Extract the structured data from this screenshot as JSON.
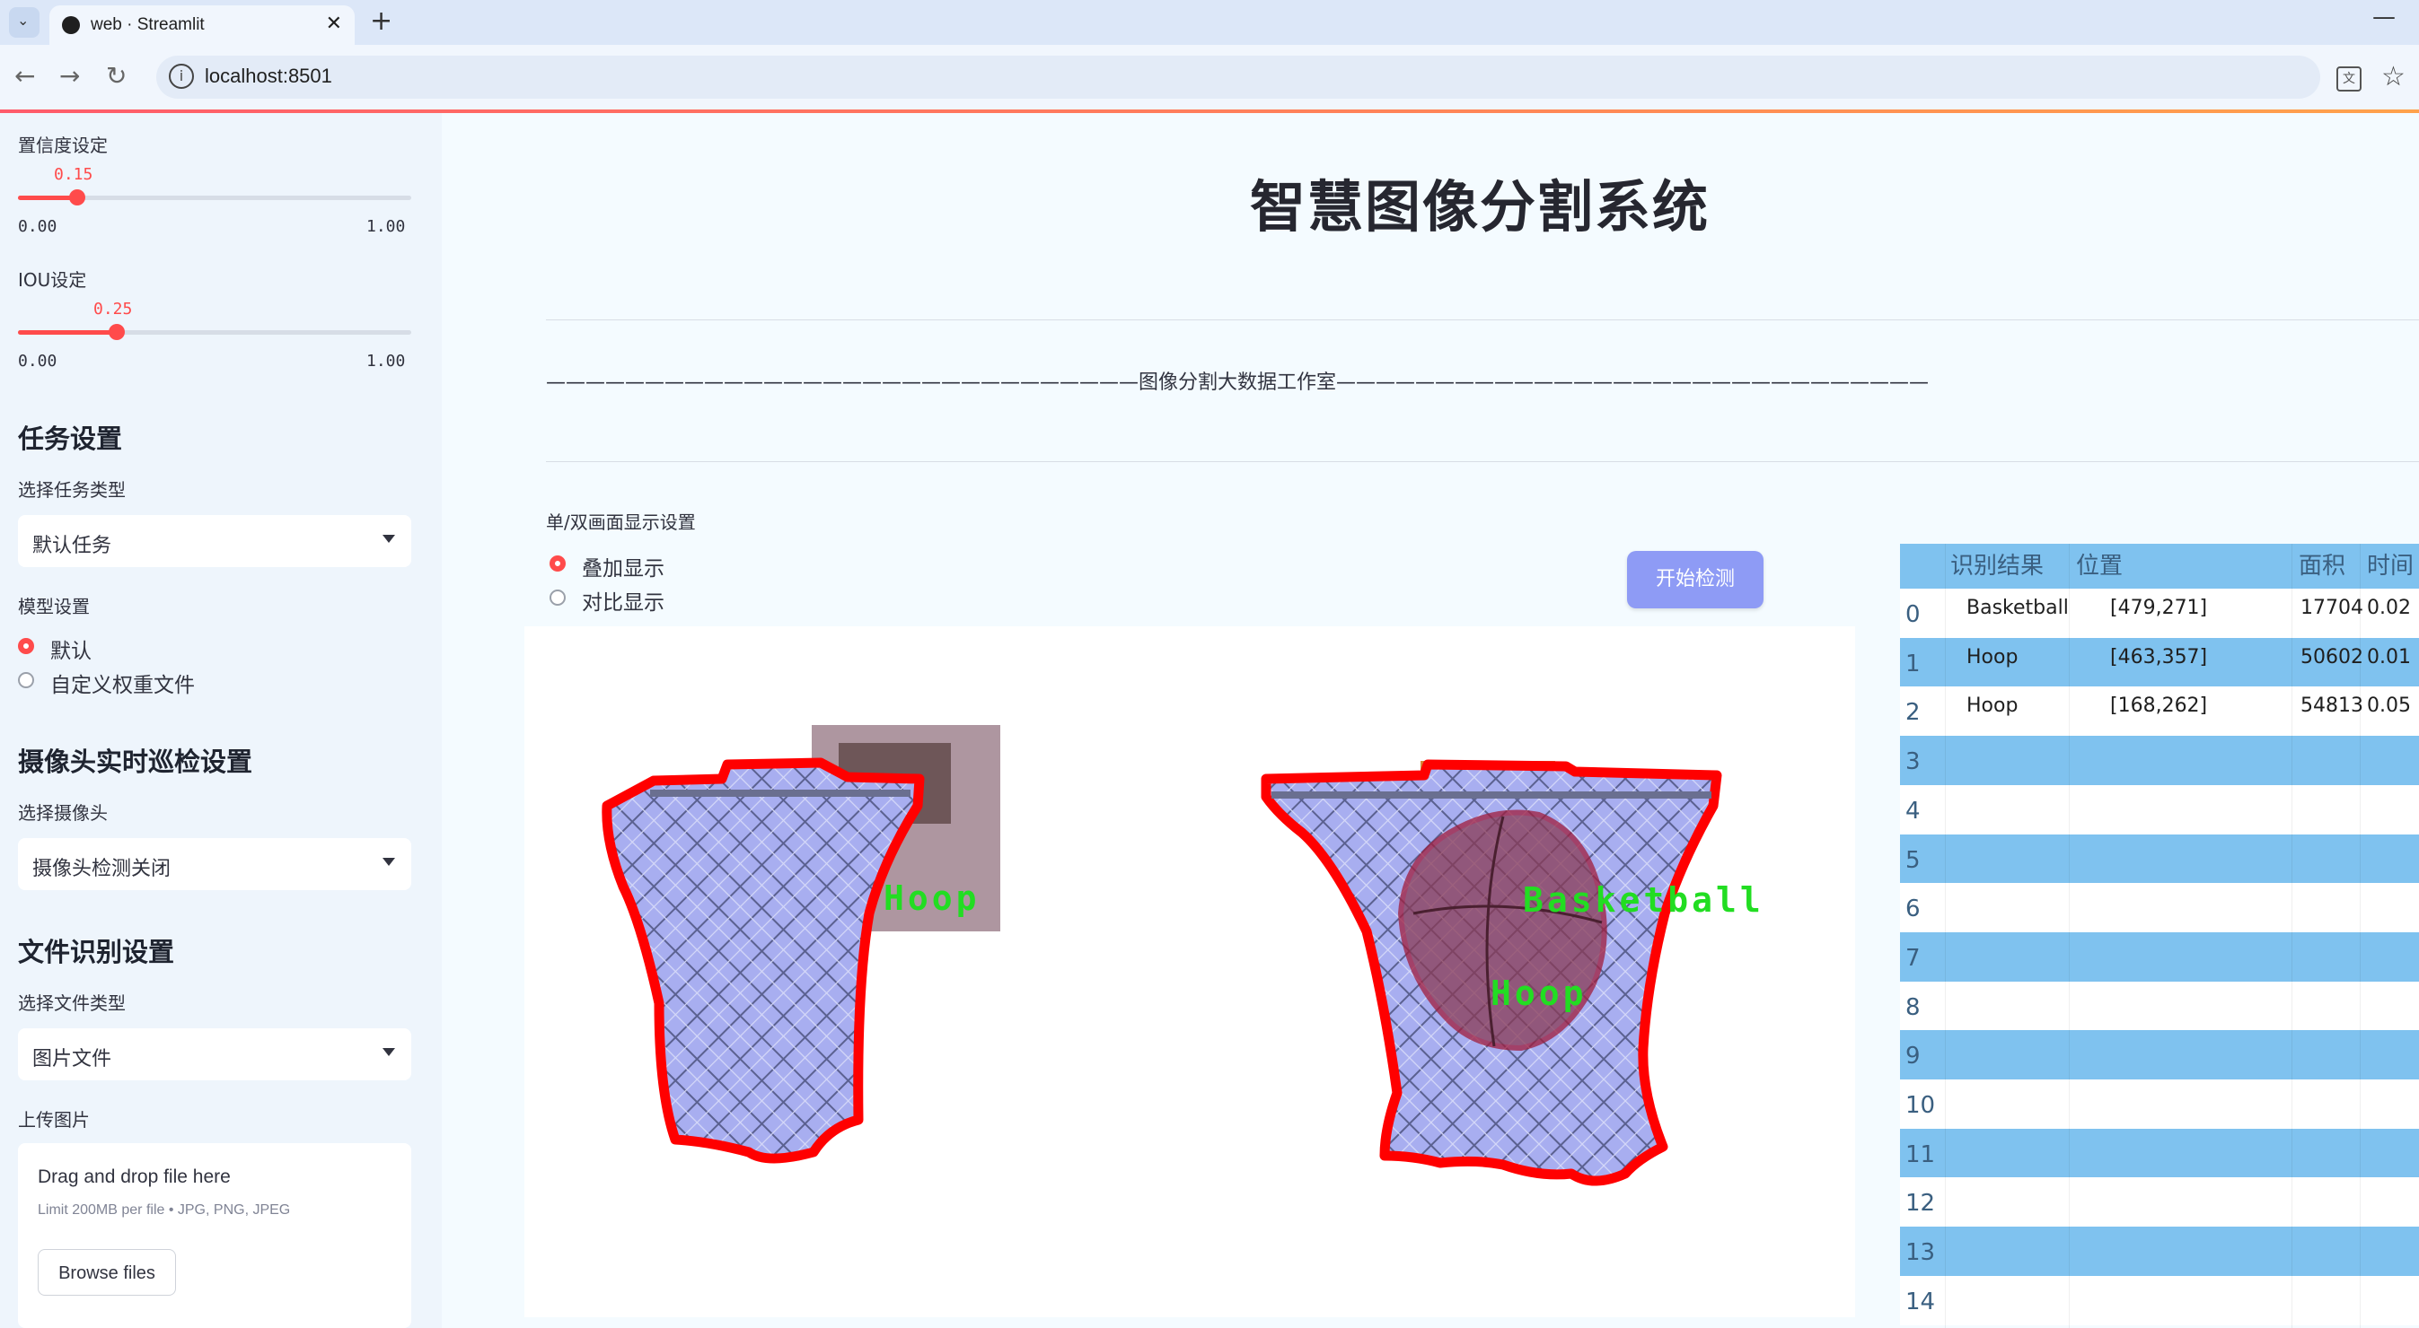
{
  "browser": {
    "tab_title": "web · Streamlit",
    "url": "localhost:8501"
  },
  "sidebar": {
    "confidence": {
      "label": "置信度设定",
      "value": "0.15",
      "fraction": 0.15,
      "min": "0.00",
      "max": "1.00"
    },
    "iou": {
      "label": "IOU设定",
      "value": "0.25",
      "fraction": 0.25,
      "min": "0.00",
      "max": "1.00"
    },
    "task_header": "任务设置",
    "task_type_label": "选择任务类型",
    "task_type_value": "默认任务",
    "model_label": "模型设置",
    "model_options": [
      "默认",
      "自定义权重文件"
    ],
    "camera_header": "摄像头实时巡检设置",
    "camera_label": "选择摄像头",
    "camera_value": "摄像头检测关闭",
    "file_header": "文件识别设置",
    "file_type_label": "选择文件类型",
    "file_type_value": "图片文件",
    "upload_label": "上传图片",
    "uploader": {
      "title": "Drag and drop file here",
      "subtitle": "Limit 200MB per file • JPG, PNG, JPEG",
      "button": "Browse files"
    }
  },
  "main": {
    "title": "智慧图像分割系统",
    "banner": "——————————————————————————————图像分割大数据工作室——————————————————————————————",
    "display_label": "单/双画面显示设置",
    "display_options": [
      "叠加显示",
      "对比显示"
    ],
    "start_button": "开始检测",
    "image_labels": {
      "hoop_left": "Hoop",
      "basketball": "Basketball",
      "hoop_right": "Hoop"
    }
  },
  "table": {
    "headers": [
      "识别结果",
      "位置",
      "面积",
      "时间"
    ],
    "rows": [
      {
        "index": "0",
        "result": "Basketball",
        "position": "[479,271]",
        "area": "17704",
        "time": "0.02"
      },
      {
        "index": "1",
        "result": "Hoop",
        "position": "[463,357]",
        "area": "50602",
        "time": "0.01"
      },
      {
        "index": "2",
        "result": "Hoop",
        "position": "[168,262]",
        "area": "54813",
        "time": "0.05"
      },
      {
        "index": "3"
      },
      {
        "index": "4"
      },
      {
        "index": "5"
      },
      {
        "index": "6"
      },
      {
        "index": "7"
      },
      {
        "index": "8"
      },
      {
        "index": "9"
      },
      {
        "index": "10"
      },
      {
        "index": "11"
      },
      {
        "index": "12"
      },
      {
        "index": "13"
      },
      {
        "index": "14"
      }
    ]
  },
  "colors": {
    "accent": "#ff4b4b",
    "button": "#8e9bf5",
    "table_stripe": "#7fc2ef",
    "mask_outline": "#ff0000",
    "label_green": "#22dd22"
  }
}
